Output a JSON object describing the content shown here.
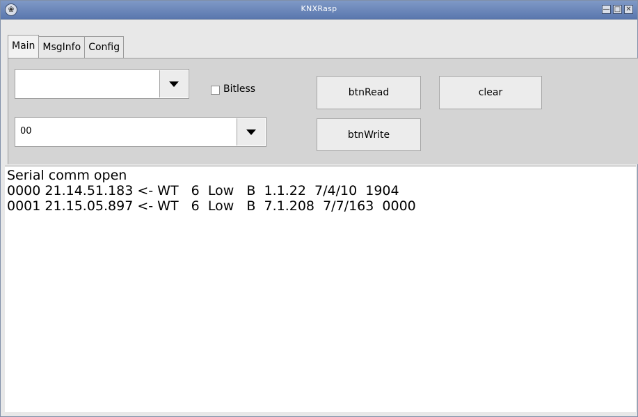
{
  "window": {
    "title": "KNXRasp"
  },
  "tabs": [
    {
      "label": "Main"
    },
    {
      "label": "MsgInfo"
    },
    {
      "label": "Config"
    }
  ],
  "controls": {
    "combo1_value": "",
    "combo2_value": "00",
    "bitless_label": "Bitless",
    "bitless_checked": false,
    "btn_read": "btnRead",
    "btn_clear": "clear",
    "btn_write": "btnWrite"
  },
  "log": {
    "lines": [
      "Serial comm open",
      "0000 21.14.51.183 <- WT   6  Low   B  1.1.22  7/4/10  1904",
      "0001 21.15.05.897 <- WT   6  Low   B  7.1.208  7/7/163  0000"
    ]
  }
}
